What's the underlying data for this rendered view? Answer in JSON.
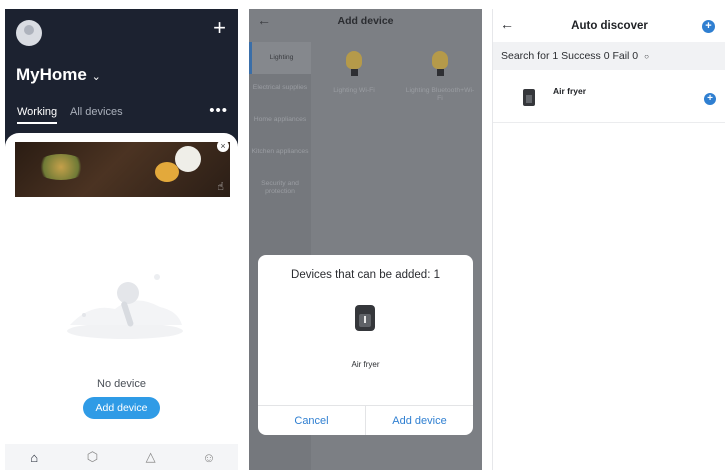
{
  "home_screen": {
    "add_icon": "+",
    "home_name": "MyHome",
    "home_chevron": "⌄",
    "tabs": [
      "Working",
      "All devices"
    ],
    "more_icon": "•••",
    "banner_close_icon": "×",
    "empty_text": "No device",
    "add_device_label": "Add device",
    "nav_icons": [
      "home-icon",
      "cube-icon",
      "scene-icon",
      "profile-icon"
    ]
  },
  "add_device_screen": {
    "back_icon": "←",
    "title": "Add device",
    "categories": [
      "Lighting",
      "Electrical supplies",
      "Home appliances",
      "Kitchen appliances",
      "Security and protection"
    ],
    "products": [
      {
        "label": "Lighting Wi-Fi"
      },
      {
        "label": "Lighting Bluetooth+Wi-Fi"
      }
    ],
    "dialog": {
      "title": "Devices that can be added: 1",
      "device_name": "Air fryer",
      "cancel_label": "Cancel",
      "confirm_label": "Add device"
    }
  },
  "auto_discover_screen": {
    "back_icon": "←",
    "title": "Auto discover",
    "add_icon": "+",
    "status_text": "Search for 1  Success 0  Fail 0",
    "refresh_icon": "○",
    "device_name": "Air fryer",
    "device_add_icon": "+"
  },
  "colors": {
    "accent_blue": "#2f9be6",
    "link_blue": "#2f7fd1",
    "dark_header": "#1c2230",
    "overlay_gray": "#7c7f84"
  }
}
